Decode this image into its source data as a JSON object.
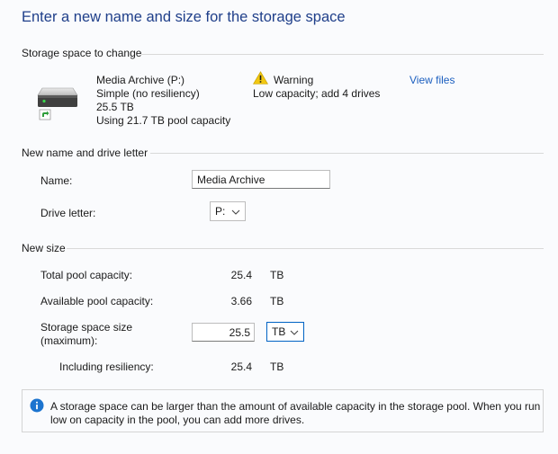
{
  "title": "Enter a new name and size for the storage space",
  "storage_section": {
    "heading": "Storage space to change",
    "drive_name": "Media Archive (P:)",
    "resiliency": "Simple (no resiliency)",
    "size": "25.5 TB",
    "pool_usage": "Using 21.7 TB pool capacity",
    "warning_title": "Warning",
    "warning_text": "Low capacity; add 4 drives",
    "view_files_link": "View files"
  },
  "name_section": {
    "heading": "New name and drive letter",
    "name_label": "Name:",
    "name_value": "Media Archive",
    "drive_letter_label": "Drive letter:",
    "drive_letter_value": "P:"
  },
  "size_section": {
    "heading": "New size",
    "total_label": "Total pool capacity:",
    "total_value": "25.4",
    "total_unit": "TB",
    "available_label": "Available pool capacity:",
    "available_value": "3.66",
    "available_unit": "TB",
    "size_label_line1": "Storage space size",
    "size_label_line2": "(maximum):",
    "size_value": "25.5",
    "size_unit": "TB",
    "resiliency_label": "Including resiliency:",
    "resiliency_value": "25.4",
    "resiliency_unit": "TB"
  },
  "info": {
    "line1": "A storage space can be larger than the amount of available capacity in the storage pool. When you run",
    "line2": "low on capacity in the pool, you can add more drives."
  },
  "colors": {
    "title": "#1f3f8a",
    "link": "#1c5fbf",
    "warning": "#f2c811",
    "info": "#1c74cf",
    "focus_border": "#0063c4"
  }
}
